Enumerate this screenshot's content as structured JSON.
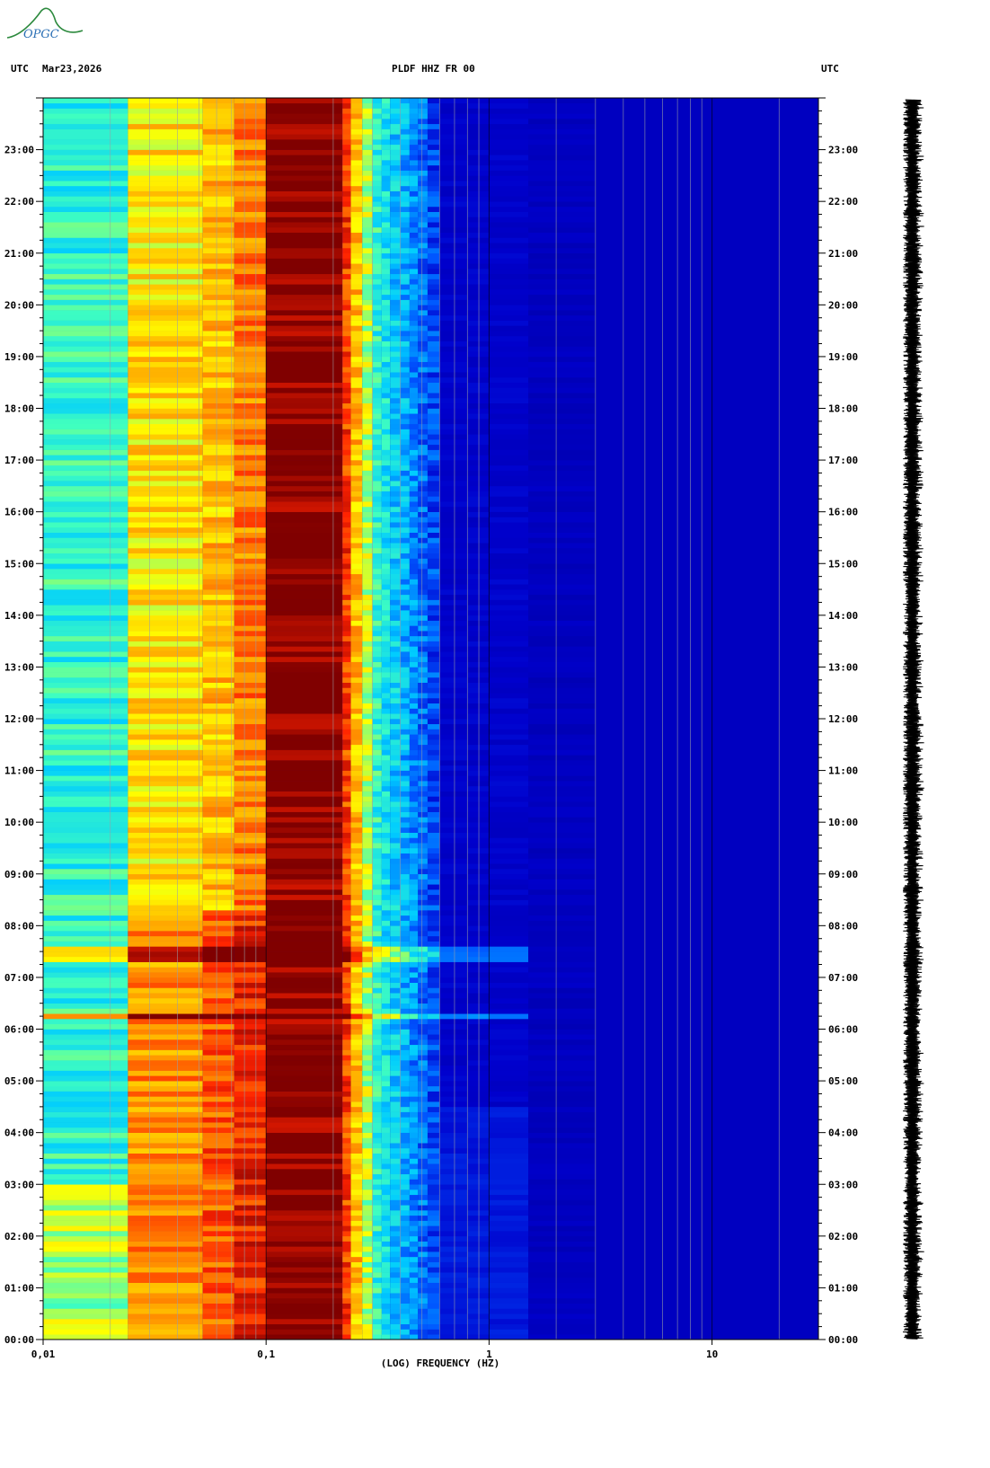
{
  "logo_text": "OPGC",
  "header": {
    "left_tz": "UTC",
    "date": "Mar23,2026",
    "channel": "PLDF HHZ FR 00",
    "right_tz": "UTC"
  },
  "chart_data": {
    "type": "heatmap",
    "title": "PLDF HHZ FR 00",
    "xlabel": "(LOG) FREQUENCY (HZ)",
    "ylabel": "UTC",
    "x_scale": "log",
    "xlim": [
      0.01,
      30
    ],
    "ylim": [
      "00:00",
      "24:00"
    ],
    "x_tick_labels": [
      "0,01",
      "0,1",
      "1",
      "10"
    ],
    "x_tick_values": [
      0.01,
      0.1,
      1,
      10
    ],
    "y_tick_labels": [
      "00:00",
      "01:00",
      "02:00",
      "03:00",
      "04:00",
      "05:00",
      "06:00",
      "07:00",
      "08:00",
      "09:00",
      "10:00",
      "11:00",
      "12:00",
      "13:00",
      "14:00",
      "15:00",
      "16:00",
      "17:00",
      "18:00",
      "19:00",
      "20:00",
      "21:00",
      "22:00",
      "23:00"
    ],
    "grid": true,
    "colormap": [
      "#00008b",
      "#0000cd",
      "#0055ff",
      "#00ccff",
      "#40ffbf",
      "#ffff00",
      "#ff9900",
      "#ff2200",
      "#800000"
    ],
    "bands": [
      {
        "f_min": 0.01,
        "f_max": 0.024,
        "level": "cyan-green"
      },
      {
        "f_min": 0.024,
        "f_max": 0.052,
        "level": "yellow"
      },
      {
        "f_min": 0.052,
        "f_max": 0.072,
        "level": "yellow-orange"
      },
      {
        "f_min": 0.072,
        "f_max": 0.1,
        "level": "orange-red"
      },
      {
        "f_min": 0.1,
        "f_max": 0.22,
        "level": "dark-red (peak)"
      },
      {
        "f_min": 0.22,
        "f_max": 0.3,
        "level": "red-yellow"
      },
      {
        "f_min": 0.3,
        "f_max": 0.55,
        "level": "cyan-blue"
      },
      {
        "f_min": 0.55,
        "f_max": 30,
        "level": "dark blue"
      }
    ],
    "events": [
      {
        "time": "07:25",
        "note": "strong low-frequency energy 0.01–0.07 Hz"
      },
      {
        "time": "06:15",
        "note": "broadband line to ~1.5 Hz"
      }
    ]
  },
  "colors": {
    "peak": "#800000",
    "background_blue": "#0a1aa8",
    "grid": "#9aa0a6"
  }
}
